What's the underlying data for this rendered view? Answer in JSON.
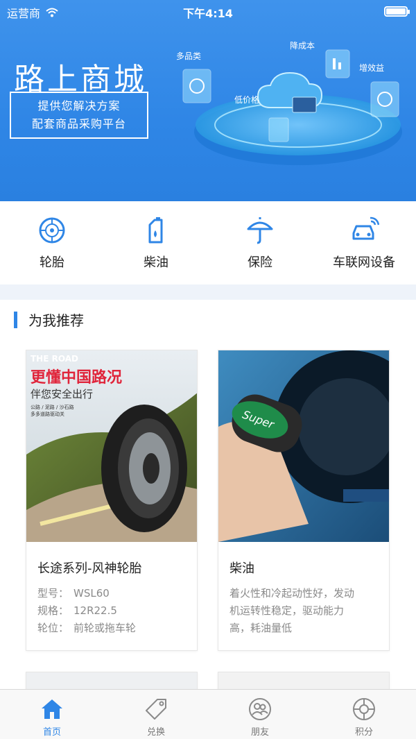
{
  "status_bar": {
    "carrier": "运营商",
    "time": "下午4:14"
  },
  "banner": {
    "title": "路上商城",
    "subtitle_line1": "提供您解决方案",
    "subtitle_line2": "配套商品采购平台",
    "tags": [
      "多品类",
      "降成本",
      "增效益",
      "低价格"
    ]
  },
  "categories": [
    {
      "label": "轮胎",
      "icon": "tire-icon"
    },
    {
      "label": "柴油",
      "icon": "fuel-can-icon"
    },
    {
      "label": "保险",
      "icon": "umbrella-icon"
    },
    {
      "label": "车联网设备",
      "icon": "connected-car-icon"
    }
  ],
  "section": {
    "title": "为我推荐"
  },
  "products": [
    {
      "title": "长途系列-风神轮胎",
      "image_text": {
        "brand": "THE ROAD",
        "headline": "更懂中国路况",
        "tagline": "伴您安全出行",
        "small1": "公路 / 泥路 / 沙石路",
        "small2": "多多道路驱动关"
      },
      "meta": [
        {
          "key": "型号：",
          "value": "WSL60"
        },
        {
          "key": "规格：",
          "value": "12R22.5"
        },
        {
          "key": "轮位：",
          "value": "前轮或拖车轮"
        }
      ]
    },
    {
      "title": "柴油",
      "image_text": {
        "nozzle_label": "Super"
      },
      "description": [
        "着火性和冷起动性好，发动",
        "机运转性稳定，驱动能力",
        "高，耗油量低"
      ]
    }
  ],
  "tabbar": [
    {
      "label": "首页",
      "icon": "home-icon",
      "active": true
    },
    {
      "label": "兑换",
      "icon": "tag-icon",
      "active": false
    },
    {
      "label": "朋友",
      "icon": "friends-icon",
      "active": false
    },
    {
      "label": "积分",
      "icon": "points-icon",
      "active": false
    }
  ],
  "colors": {
    "primary": "#2f86e6",
    "banner_top": "#3f93ec",
    "divider": "#eef3fa"
  }
}
